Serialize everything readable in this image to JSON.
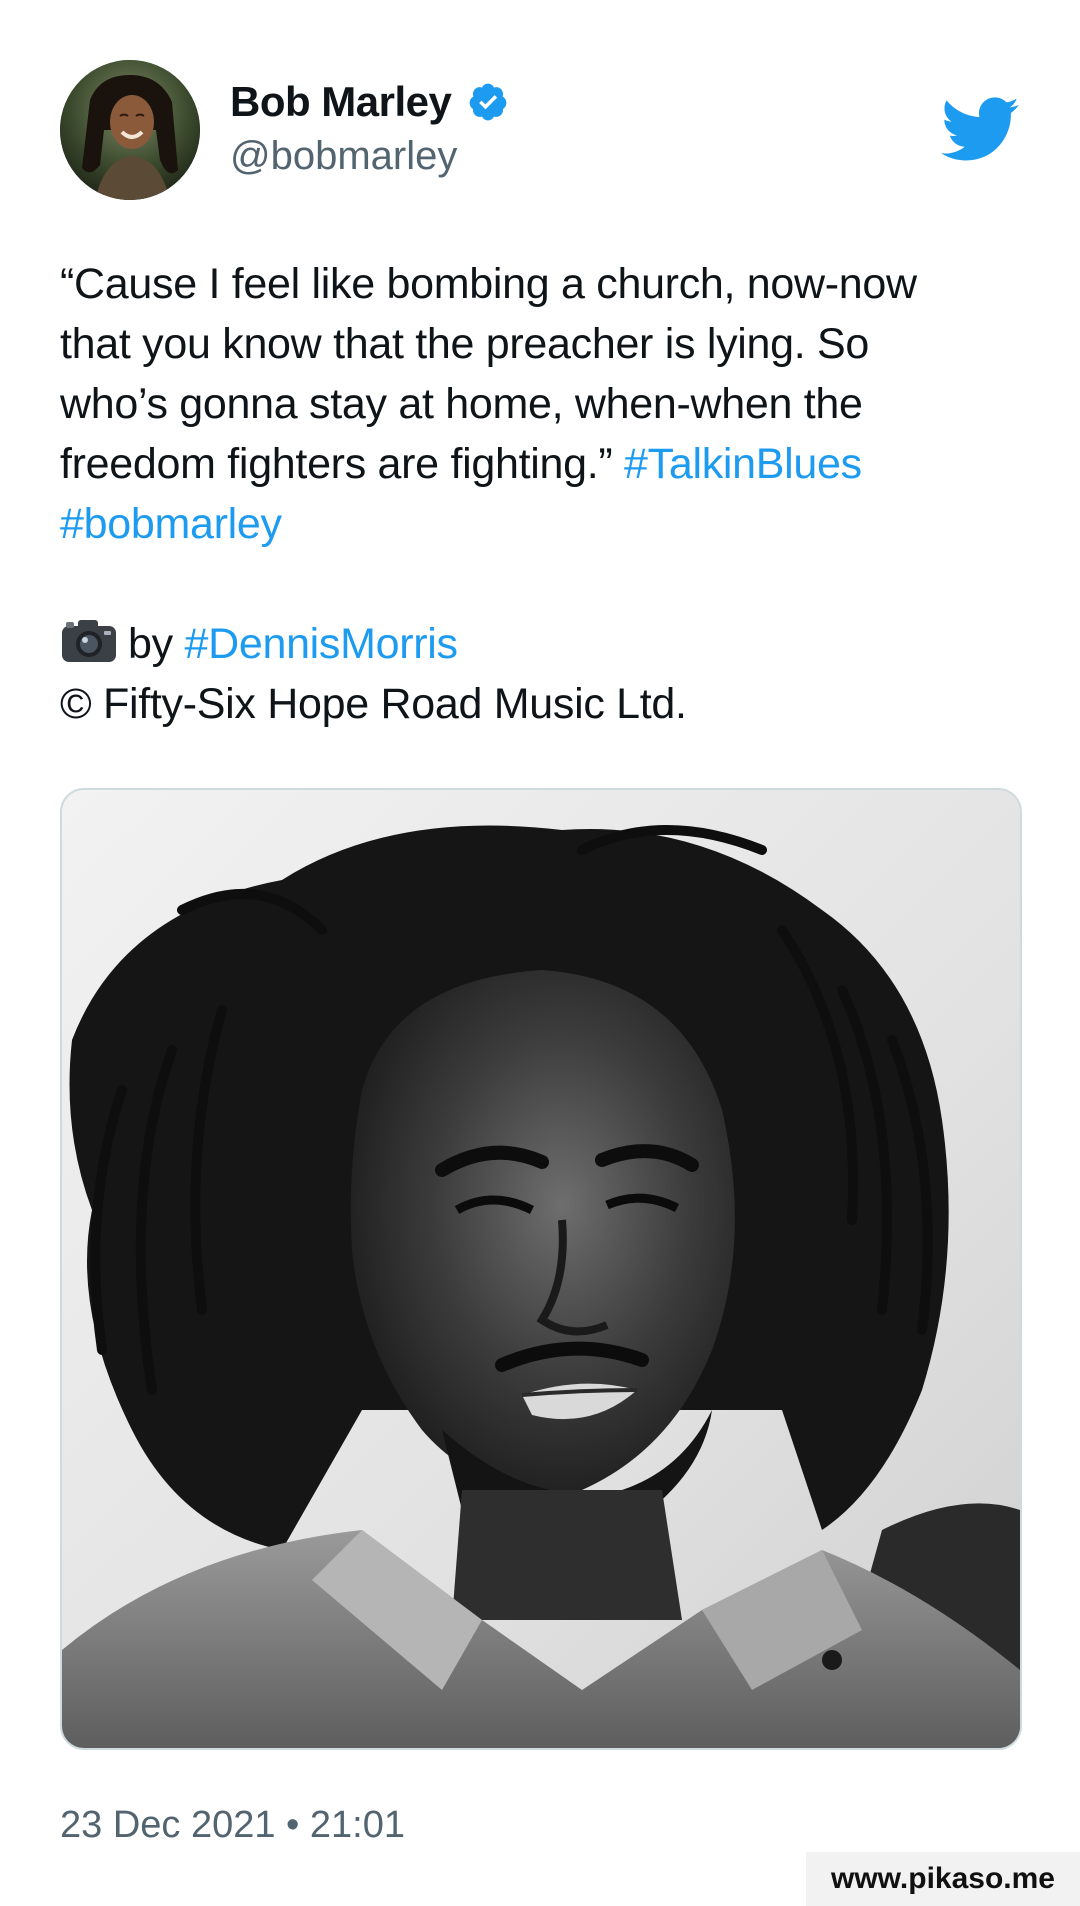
{
  "author": {
    "display_name": "Bob Marley",
    "handle": "@bobmarley",
    "verified_icon": "verified-badge-icon",
    "avatar_icon": "avatar"
  },
  "brand": {
    "logo_icon": "twitter-bird-icon",
    "accent_color": "#1d9bf0",
    "text_color": "#0f1419",
    "muted_color": "#536471"
  },
  "tweet": {
    "line1": "“Cause I feel like bombing a church, now-now",
    "line2": "that you know that the preacher is lying. So",
    "line3": "who’s gonna stay at home, when-when the",
    "line4_text": "freedom fighters are fighting.” ",
    "hashtag1": "#TalkinBlues",
    "hashtag2": "#bobmarley",
    "camera_emoji_icon": "camera-icon",
    "credit_by": "by ",
    "hashtag3": "#DennisMorris",
    "copyright": "© Fifty-Six Hope Road Music Ltd."
  },
  "media": {
    "photo_icon": "photo"
  },
  "timestamp": "23 Dec 2021 • 21:01",
  "watermark": "www.pikaso.me"
}
